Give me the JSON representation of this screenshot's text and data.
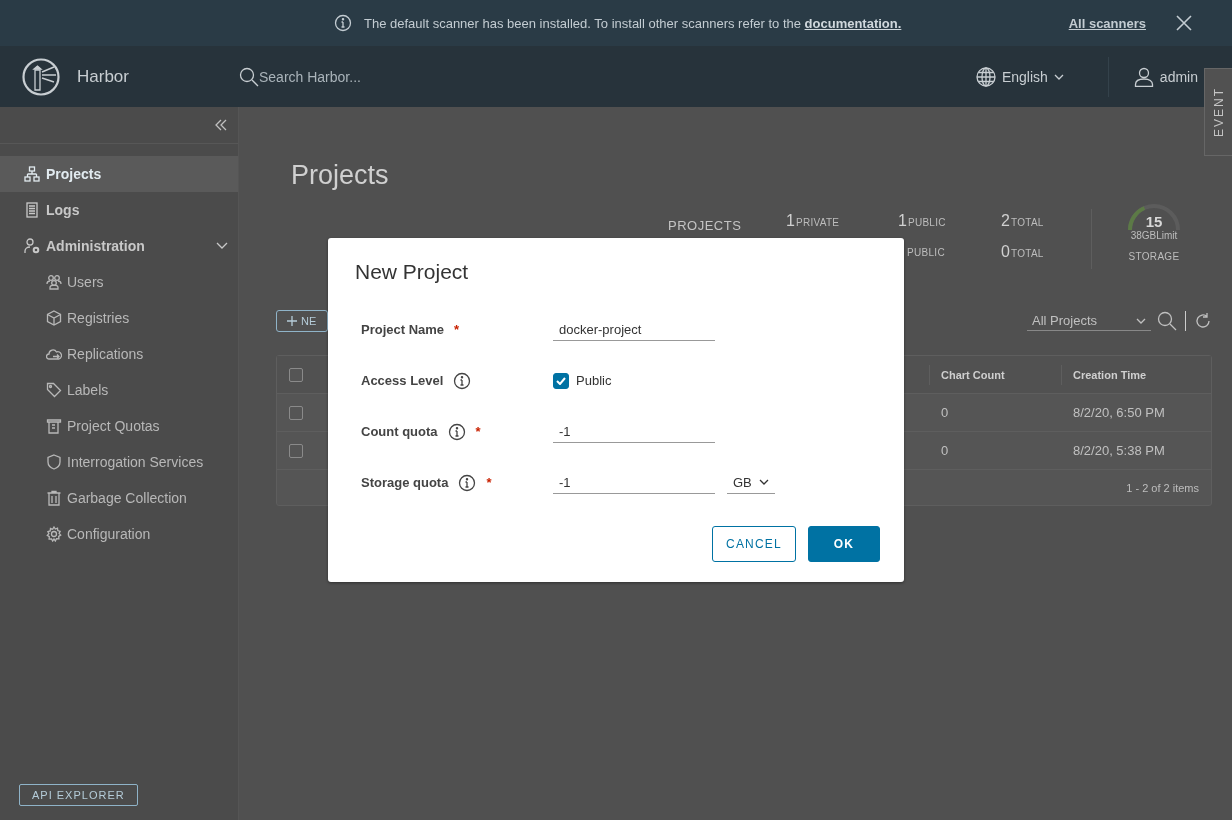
{
  "banner": {
    "message": "The default scanner has been installed. To install other scanners refer to the",
    "link": "documentation.",
    "action": "All scanners"
  },
  "header": {
    "brand": "Harbor",
    "search_placeholder": "Search Harbor...",
    "language": "English",
    "user": "admin"
  },
  "event_tab": "EVENT",
  "sidebar": {
    "items": [
      {
        "label": "Projects",
        "selected": true
      },
      {
        "label": "Logs",
        "selected": false
      },
      {
        "label": "Administration",
        "selected": false,
        "expanded": true,
        "children": [
          {
            "label": "Users",
            "selected": false
          },
          {
            "label": "Registries",
            "selected": false
          },
          {
            "label": "Replications",
            "selected": false
          },
          {
            "label": "Labels",
            "selected": false
          },
          {
            "label": "Project Quotas",
            "selected": false
          },
          {
            "label": "Interrogation Services",
            "selected": false
          },
          {
            "label": "Garbage Collection",
            "selected": false
          },
          {
            "label": "Configuration",
            "selected": false
          }
        ]
      }
    ],
    "api_button": "API EXPLORER"
  },
  "page": {
    "title": "Projects",
    "stats": {
      "projects": {
        "label": "PROJECTS",
        "counts": [
          {
            "value": "1",
            "label": "PRIVATE"
          },
          {
            "value": "1",
            "label": "PUBLIC"
          },
          {
            "value": "2",
            "label": "TOTAL"
          }
        ]
      },
      "repositories": {
        "counts": [
          {
            "label": "PUBLIC"
          },
          {
            "value": "0",
            "label": "TOTAL"
          }
        ]
      },
      "storage": {
        "value": "15",
        "limit": "38GBLimit",
        "label": "STORAGE",
        "level": 0.3
      }
    },
    "new_button": "NE",
    "filter": "All Projects",
    "table": {
      "header_checked": false,
      "columns": [
        "Chart Count",
        "Creation Time"
      ],
      "rows": [
        {
          "checked": false,
          "cells": [
            "0",
            "8/2/20, 6:50 PM"
          ]
        },
        {
          "checked": false,
          "cells": [
            "0",
            "8/2/20, 5:38 PM"
          ]
        }
      ],
      "footer": "1 - 2 of 2 items"
    }
  },
  "dialog": {
    "title": "New Project",
    "fields": [
      {
        "kind": "text",
        "label": "Project Name",
        "required_mark": "*",
        "info": false,
        "value": "docker-project"
      },
      {
        "kind": "checkbox",
        "label": "Access Level",
        "info": true,
        "option": "Public",
        "checked": true
      },
      {
        "kind": "text",
        "label": "Count quota",
        "required_mark": "*",
        "info": true,
        "value": "-1"
      },
      {
        "kind": "text",
        "label": "Storage quota",
        "required_mark": "*",
        "info": true,
        "value": "-1",
        "unit": "GB"
      }
    ],
    "buttons": [
      {
        "kind": "outline",
        "label": "CANCEL"
      },
      {
        "kind": "primary",
        "label": "OK"
      }
    ]
  }
}
